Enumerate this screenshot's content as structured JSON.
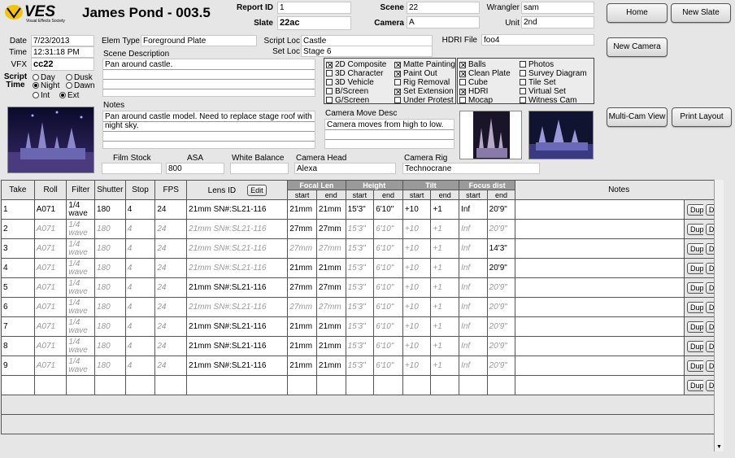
{
  "header": {
    "logo_text": "VES",
    "logo_sub": "Visual Effects Society",
    "title": "James Pond - 003.5",
    "report_id_label": "Report ID",
    "report_id": "1",
    "slate_label": "Slate",
    "slate": "22ac",
    "scene_label": "Scene",
    "scene": "22",
    "camera_label": "Camera",
    "camera": "A",
    "wrangler_label": "Wrangler",
    "wrangler": "sam",
    "unit_label": "Unit",
    "unit": "2nd"
  },
  "buttons": {
    "home": "Home",
    "new_slate": "New Slate",
    "new_camera": "New Camera",
    "multi_cam": "Multi-Cam View",
    "print_layout": "Print Layout"
  },
  "left": {
    "date_label": "Date",
    "date": "7/23/2013",
    "time_label": "Time",
    "time": "12:31:18 PM",
    "vfx_label": "VFX",
    "vfx": "cc22",
    "script_time_label": "Script Time",
    "radios": [
      {
        "label": "Day",
        "on": false
      },
      {
        "label": "Dusk",
        "on": false
      },
      {
        "label": "Night",
        "on": true
      },
      {
        "label": "Dawn",
        "on": false
      },
      {
        "label": "Int",
        "on": false
      },
      {
        "label": "Ext",
        "on": true
      }
    ]
  },
  "element": {
    "elem_type_label": "Elem Type",
    "elem_type": "Foreground Plate",
    "script_loc_label": "Script Loc",
    "script_loc": "Castle",
    "set_loc_label": "Set Loc",
    "set_loc": "Stage 6",
    "hdri_file_label": "HDRI File",
    "hdri_file": "foo4",
    "scene_desc_label": "Scene Description",
    "scene_desc": "Pan around castle.",
    "notes_label": "Notes",
    "notes": "Pan around castle model. Need to replace stage roof with night sky.",
    "camera_move_label": "Camera Move Desc",
    "camera_move": "Camera moves from high to low."
  },
  "checks1": [
    {
      "label": "2D Composite",
      "on": true
    },
    {
      "label": "3D Character",
      "on": false
    },
    {
      "label": "3D Vehicle",
      "on": false
    },
    {
      "label": "B/Screen",
      "on": false
    },
    {
      "label": "G/Screen",
      "on": false
    },
    {
      "label": "Matte Painting",
      "on": true
    },
    {
      "label": "Paint Out",
      "on": true
    },
    {
      "label": "Rig Removal",
      "on": false
    },
    {
      "label": "Set Extension",
      "on": true
    },
    {
      "label": "Under Protest",
      "on": false
    }
  ],
  "checks2": [
    {
      "label": "Balls",
      "on": true
    },
    {
      "label": "Clean Plate",
      "on": true
    },
    {
      "label": "Cube",
      "on": false
    },
    {
      "label": "HDRI",
      "on": true
    },
    {
      "label": "Mocap",
      "on": false
    },
    {
      "label": "Photos",
      "on": false
    },
    {
      "label": "Survey Diagram",
      "on": false
    },
    {
      "label": "Tile Set",
      "on": false
    },
    {
      "label": "Virtual Set",
      "on": false
    },
    {
      "label": "Witness Cam",
      "on": false
    }
  ],
  "camera_info": {
    "film_stock_label": "Film Stock",
    "film_stock": "",
    "asa_label": "ASA",
    "asa": "800",
    "white_balance_label": "White Balance",
    "white_balance": "",
    "camera_head_label": "Camera Head",
    "camera_head": "Alexa",
    "camera_rig_label": "Camera Rig",
    "camera_rig": "Technocrane"
  },
  "table": {
    "headers": {
      "take": "Take",
      "roll": "Roll",
      "filter": "Filter",
      "shutter": "Shutter",
      "stop": "Stop",
      "fps": "FPS",
      "lens_id": "Lens ID",
      "edit": "Edit",
      "focal_len": "Focal Len",
      "height": "Height",
      "tilt": "Tilt",
      "focus_dist": "Focus dist",
      "start": "start",
      "end": "end",
      "notes": "Notes"
    },
    "dup": "Dup",
    "del": "Del",
    "rows": [
      {
        "take": "1",
        "roll": "A071",
        "filter": "1/4 wave",
        "shutter": "180",
        "stop": "4",
        "fps": "24",
        "lens": "21mm SN#:SL21-116",
        "fl_s": "21mm",
        "fl_e": "21mm",
        "h_s": "15'3\"",
        "h_e": "6'10\"",
        "t_s": "+10",
        "t_e": "+1",
        "f_s": "Inf",
        "f_e": "20'9\"",
        "ghost": false
      },
      {
        "take": "2",
        "roll": "A071",
        "filter": "1/4 wave",
        "shutter": "180",
        "stop": "4",
        "fps": "24",
        "lens": "21mm SN#:SL21-116",
        "fl_s": "27mm",
        "fl_e": "27mm",
        "h_s": "15'3\"",
        "h_e": "6'10\"",
        "t_s": "+10",
        "t_e": "+1",
        "f_s": "Inf",
        "f_e": "20'9\"",
        "ghost": true,
        "nonghost_cols": [
          "fl_s",
          "fl_e"
        ]
      },
      {
        "take": "3",
        "roll": "A071",
        "filter": "1/4 wave",
        "shutter": "180",
        "stop": "4",
        "fps": "24",
        "lens": "21mm SN#:SL21-116",
        "fl_s": "27mm",
        "fl_e": "27mm",
        "h_s": "15'3\"",
        "h_e": "6'10\"",
        "t_s": "+10",
        "t_e": "+1",
        "f_s": "Inf",
        "f_e": "14'3\"",
        "ghost": true,
        "nonghost_cols": [
          "f_e"
        ]
      },
      {
        "take": "4",
        "roll": "A071",
        "filter": "1/4 wave",
        "shutter": "180",
        "stop": "4",
        "fps": "24",
        "lens": "21mm SN#:SL21-116",
        "fl_s": "21mm",
        "fl_e": "21mm",
        "h_s": "15'3\"",
        "h_e": "6'10\"",
        "t_s": "+10",
        "t_e": "+1",
        "f_s": "Inf",
        "f_e": "20'9\"",
        "ghost": true,
        "nonghost_cols": [
          "fl_s",
          "fl_e",
          "f_e"
        ]
      },
      {
        "take": "5",
        "roll": "A071",
        "filter": "1/4 wave",
        "shutter": "180",
        "stop": "4",
        "fps": "24",
        "lens": "21mm SN#:SL21-116",
        "fl_s": "27mm",
        "fl_e": "27mm",
        "h_s": "15'3\"",
        "h_e": "6'10\"",
        "t_s": "+10",
        "t_e": "+1",
        "f_s": "Inf",
        "f_e": "20'9\"",
        "ghost": true,
        "nonghost_cols": [
          "lens",
          "fl_s",
          "fl_e"
        ]
      },
      {
        "take": "6",
        "roll": "A071",
        "filter": "1/4 wave",
        "shutter": "180",
        "stop": "4",
        "fps": "24",
        "lens": "21mm SN#:SL21-116",
        "fl_s": "27mm",
        "fl_e": "27mm",
        "h_s": "15'3\"",
        "h_e": "6'10\"",
        "t_s": "+10",
        "t_e": "+1",
        "f_s": "Inf",
        "f_e": "20'9\"",
        "ghost": true,
        "nonghost_cols": []
      },
      {
        "take": "7",
        "roll": "A071",
        "filter": "1/4 wave",
        "shutter": "180",
        "stop": "4",
        "fps": "24",
        "lens": "21mm SN#:SL21-116",
        "fl_s": "21mm",
        "fl_e": "21mm",
        "h_s": "15'3\"",
        "h_e": "6'10\"",
        "t_s": "+10",
        "t_e": "+1",
        "f_s": "Inf",
        "f_e": "20'9\"",
        "ghost": true,
        "nonghost_cols": [
          "lens",
          "fl_s",
          "fl_e"
        ]
      },
      {
        "take": "8",
        "roll": "A071",
        "filter": "1/4 wave",
        "shutter": "180",
        "stop": "4",
        "fps": "24",
        "lens": "21mm SN#:SL21-116",
        "fl_s": "21mm",
        "fl_e": "21mm",
        "h_s": "15'3\"",
        "h_e": "6'10\"",
        "t_s": "+10",
        "t_e": "+1",
        "f_s": "Inf",
        "f_e": "20'9\"",
        "ghost": true,
        "nonghost_cols": [
          "lens",
          "fl_s",
          "fl_e"
        ]
      },
      {
        "take": "9",
        "roll": "A071",
        "filter": "1/4 wave",
        "shutter": "180",
        "stop": "4",
        "fps": "24",
        "lens": "21mm SN#:SL21-116",
        "fl_s": "21mm",
        "fl_e": "21mm",
        "h_s": "15'3\"",
        "h_e": "6'10\"",
        "t_s": "+10",
        "t_e": "+1",
        "f_s": "Inf",
        "f_e": "20'9\"",
        "ghost": true,
        "nonghost_cols": [
          "lens",
          "fl_s",
          "fl_e"
        ]
      }
    ],
    "filter_words": [
      "1/4",
      "wave"
    ]
  },
  "colors": {
    "logo_yellow": "#f5c400",
    "group_header": "#9a9a9a"
  }
}
